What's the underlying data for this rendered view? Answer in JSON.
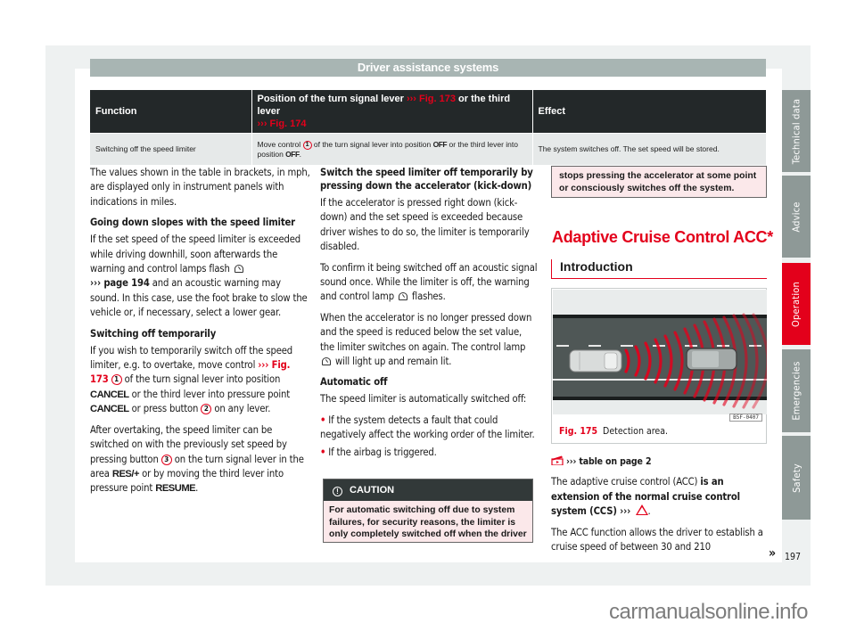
{
  "header": {
    "title": "Driver assistance systems"
  },
  "table": {
    "headers": {
      "function": "Function",
      "position_pre": "Position of the turn signal lever ",
      "position_ref1": "››› Fig. 173",
      "position_mid": " or the third lever ",
      "position_ref2": "››› Fig. 174",
      "effect": "Effect"
    },
    "rows": [
      {
        "function": "Switching off the speed limiter",
        "position_a": "Move control ",
        "position_num": "1",
        "position_b": " of the turn signal lever into position ",
        "position_kw1": "OFF",
        "position_c": " or the third lever into position ",
        "position_kw2": "OFF",
        "position_d": ".",
        "effect": "The system switches off. The set speed will be stored."
      }
    ]
  },
  "col1": {
    "intro": "The values shown in the table in brackets, in mph, are displayed only in instrument panels with indications in miles.",
    "h_slopes": "Going down slopes with the speed limiter",
    "slopes_a": "If the set speed of the speed limiter is exceeded while driving downhill, soon afterwards the warning and control lamps flash",
    "slopes_ref": "››› page 194",
    "slopes_b": " and an acoustic warning may sound. In this case, use the foot brake to slow the vehicle or, if necessary, select a lower gear.",
    "h_temp": "Switching off temporarily",
    "temp_a": "If you wish to temporarily switch off the speed limiter, e.g. to overtake, move control ",
    "temp_ref": "››› Fig. 173",
    "temp_num1": "1",
    "temp_b": " of the turn signal lever into position ",
    "temp_kw1": "CANCEL",
    "temp_c": " or the third lever into pressure point ",
    "temp_kw2": "CANCEL",
    "temp_d": " or press button ",
    "temp_num2": "2",
    "temp_e": " on any lever.",
    "after_a": "After overtaking, the speed limiter can be switched on with the previously set speed by pressing button ",
    "after_num": "3",
    "after_b": " on the turn signal lever in the area ",
    "after_kw1": "RES/+",
    "after_c": " or by moving the third lever into pressure point ",
    "after_kw2": "RESUME",
    "after_d": "."
  },
  "col2": {
    "h_kick": "Switch the speed limiter off temporarily by pressing down the accelerator (kick-down)",
    "kick_p1": "If the accelerator is pressed right down (kick-down) and the set speed is exceeded because driver wishes to do so, the limiter is temporarily disabled.",
    "kick_p2a": "To confirm it being switched off an acoustic signal sound once. While the limiter is off, the warning and control lamp",
    "kick_p2b": " flashes.",
    "kick_p3a": "When the accelerator is no longer pressed down and the speed is reduced below the set value, the limiter switches on again. The control lamp",
    "kick_p3b": " will light up and remain lit.",
    "h_auto": "Automatic off",
    "auto_p": "The speed limiter is automatically switched off:",
    "bullets": [
      "If the system detects a fault that could negatively affect the working order of the limiter.",
      "If the airbag is triggered."
    ],
    "caution_title": "CAUTION",
    "caution_body": "For automatic switching off due to system failures, for security reasons, the limiter is only completely switched off when the driver"
  },
  "col3": {
    "caution_cont": "stops pressing the accelerator at some point or consciously switches off the system.",
    "section_title": "Adaptive Cruise Control ACC*",
    "subsection": "Introduction",
    "figure": {
      "number": "Fig. 175",
      "caption": "Detection area.",
      "code": "B5F-0407"
    },
    "table_ref": "››› table on page 2",
    "acc_p1a": "The adaptive cruise control (ACC) ",
    "acc_p1b": "is an extension of the normal cruise control system (CCS)",
    "acc_p1c": " ››› ",
    "acc_p2": "The ACC function allows the driver to establish a cruise speed of between 30 and 210",
    "next": "»"
  },
  "side_tabs": [
    {
      "label": "Technical data",
      "active": false
    },
    {
      "label": "Advice",
      "active": false
    },
    {
      "label": "Operation",
      "active": true
    },
    {
      "label": "Emergencies",
      "active": false
    },
    {
      "label": "Safety",
      "active": false
    }
  ],
  "page_number": "197",
  "watermark": "carmanualsonline.info",
  "colors": {
    "accent": "#e3001b",
    "tab_gray": "#8e9997",
    "header_gray": "#a8b5b3",
    "table_dark": "#232829",
    "caution_bg": "#fbe8ea"
  }
}
